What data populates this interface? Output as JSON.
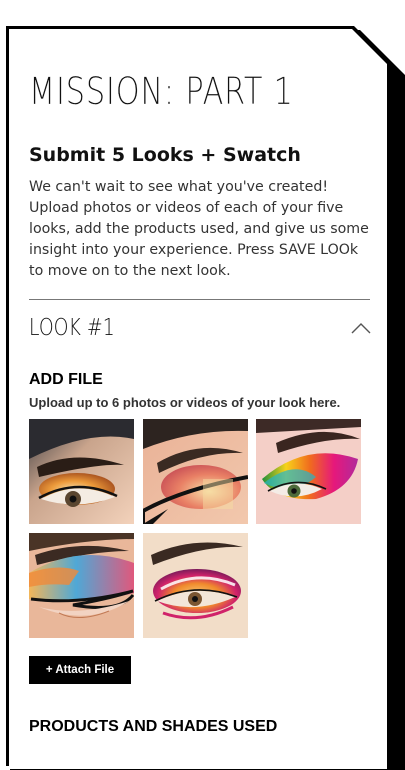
{
  "mission": {
    "title": "MISSION: PART 1"
  },
  "submit": {
    "heading": "Submit 5 Looks + Swatch",
    "description": "We can't wait to see what you've created! Upload photos or videos of each of your five looks, add the products used, and give us some insight into your experience. Press SAVE LOOk to move on to the next look."
  },
  "look": {
    "title": "LOOK #1",
    "toggle_icon": "chevron-up-icon",
    "expanded": true
  },
  "add_file": {
    "title": "ADD FILE",
    "description": "Upload up to 6 photos or videos of your look here.",
    "attach_label": "+ Attach File",
    "uploaded_images": [
      {
        "name": "look-photo-1",
        "palette": [
          "#f0c7a9",
          "#e98a2b",
          "#1b1b1b"
        ]
      },
      {
        "name": "look-photo-2",
        "palette": [
          "#f2bfa0",
          "#e2735f",
          "#f2d4a0"
        ]
      },
      {
        "name": "look-photo-3",
        "palette": [
          "#e6187b",
          "#f7d21a",
          "#23b7c9"
        ]
      },
      {
        "name": "look-photo-4",
        "palette": [
          "#f0a34a",
          "#4fa8d6",
          "#e0587c"
        ]
      },
      {
        "name": "look-photo-5",
        "palette": [
          "#d0226a",
          "#f08a2c",
          "#8a1f6a"
        ]
      }
    ]
  },
  "products": {
    "heading": "PRODUCTS AND SHADES USED"
  }
}
